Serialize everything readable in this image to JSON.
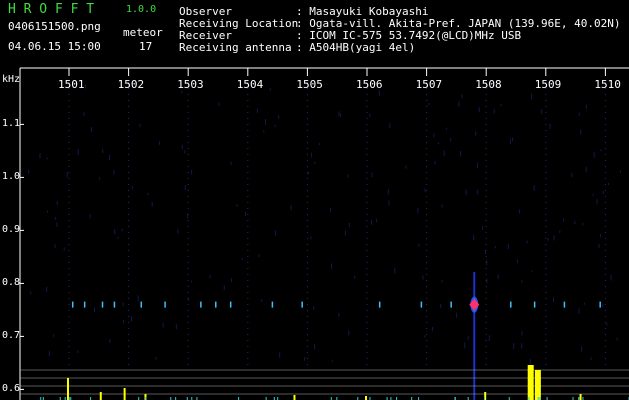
{
  "app": {
    "logo": "H R O F F T",
    "version": "1.0.0",
    "filename": "0406151500.png",
    "timestamp": "04.06.15 15:00",
    "meteor_label": "meteor",
    "meteor_count": "17"
  },
  "info": [
    {
      "label": "Observer",
      "value": ": Masayuki Kobayashi"
    },
    {
      "label": "Receiving Location",
      "value": ": Ogata-vill. Akita-Pref. JAPAN (139.96E, 40.02N)"
    },
    {
      "label": "Receiver",
      "value": ": ICOM IC-575 53.7492(@LCD)MHz USB"
    },
    {
      "label": "Receiving antenna",
      "value": ": A504HB(yagi 4el)"
    }
  ],
  "axis": {
    "y_unit": "kHz",
    "x_ticks": [
      "1501",
      "1502",
      "1503",
      "1504",
      "1505",
      "1506",
      "1507",
      "1508",
      "1509",
      "1510"
    ],
    "y_ticks": [
      "1.1",
      "1.0",
      "0.9",
      "0.8",
      "0.7",
      "0.6"
    ]
  },
  "colors": {
    "logo": "#3fdc3f",
    "grid": "#3a3aa0",
    "signal": "#ff3070",
    "histogram": "#ffff00"
  },
  "chart_data": {
    "type": "heatmap",
    "x_ticks": [
      1501,
      1502,
      1503,
      1504,
      1505,
      1506,
      1507,
      1508,
      1509,
      1510
    ],
    "y_unit": "kHz",
    "ylim": [
      0.58,
      1.18
    ],
    "y_ticks": [
      1.1,
      1.0,
      0.9,
      0.8,
      0.7,
      0.6
    ],
    "meteor_count": 17,
    "strongest_echo": {
      "x": 1507.8,
      "y": 0.76
    }
  }
}
